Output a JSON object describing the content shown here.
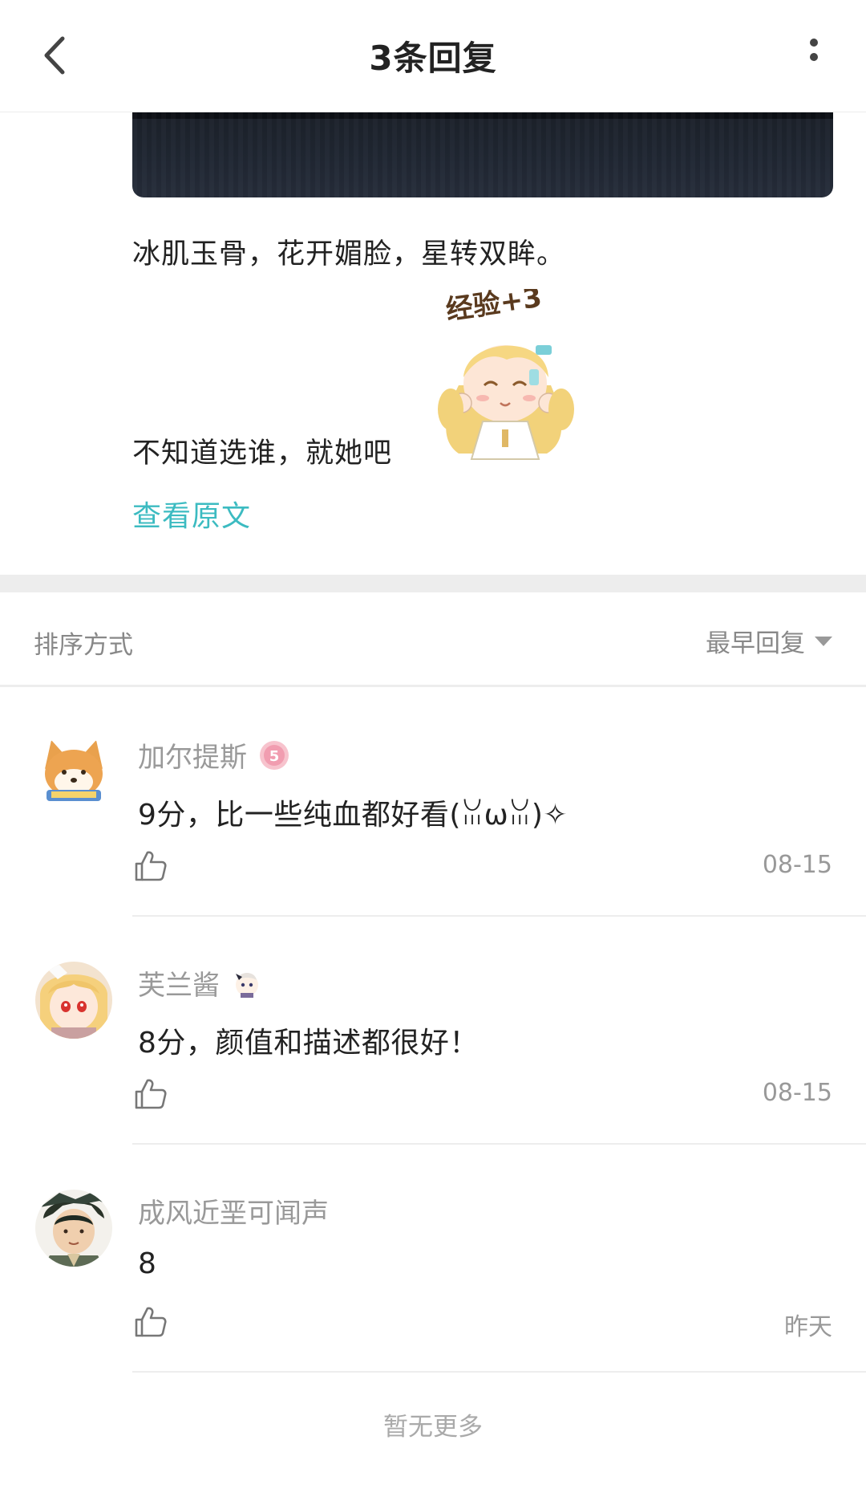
{
  "header": {
    "title": "3条回复"
  },
  "post": {
    "line1": "冰肌玉骨，花开媚脸，星转双眸。",
    "line2": "不知道选谁，就她吧",
    "sticker_text": "经验+3",
    "view_original": "查看原文"
  },
  "sort": {
    "label": "排序方式",
    "value": "最早回复"
  },
  "replies": [
    {
      "username": "加尔提斯",
      "level": "5",
      "content": "9分，比一些纯血都好看(ꈍωꈍ)✧",
      "date": "08-15"
    },
    {
      "username": "芙兰酱",
      "content": "8分，颜值和描述都很好！",
      "date": "08-15"
    },
    {
      "username": "成风近垩可闻声",
      "content": "8",
      "date": "昨天"
    }
  ],
  "footer": {
    "no_more": "暂无更多"
  },
  "colors": {
    "accent": "#3cbbc1",
    "muted": "#999999",
    "level_badge": "#f0a6b5"
  }
}
